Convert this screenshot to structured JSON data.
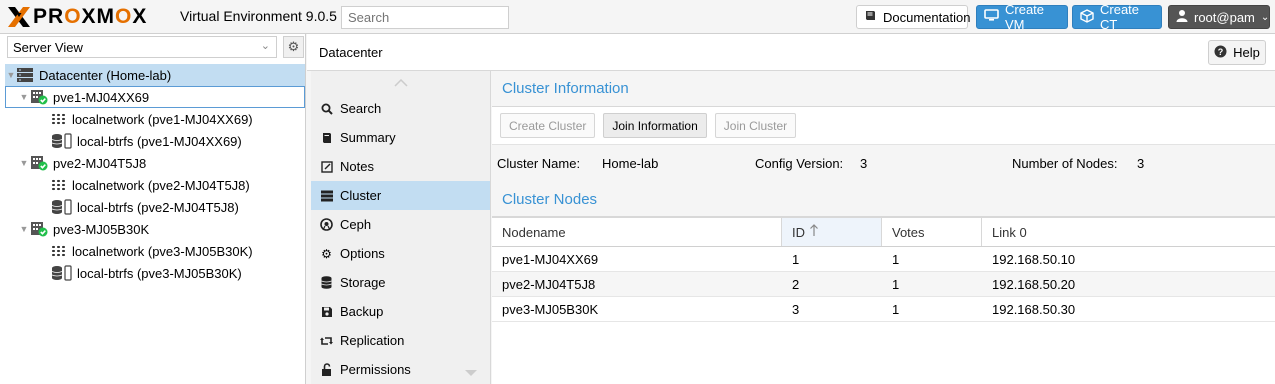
{
  "brand": {
    "logo_text": "PROXMOX",
    "version_text": "Virtual Environment 9.0.5",
    "accent": "#e57000"
  },
  "search": {
    "placeholder": "Search"
  },
  "toolbar": {
    "documentation": "Documentation",
    "create_vm": "Create VM",
    "create_ct": "Create CT",
    "user": "root@pam"
  },
  "sidebar": {
    "view_selector": "Server View",
    "tree": [
      {
        "label": "Datacenter (Home-lab)",
        "type": "datacenter"
      },
      {
        "label": "pve1-MJ04XX69",
        "type": "node"
      },
      {
        "label": "localnetwork (pve1-MJ04XX69)",
        "type": "network"
      },
      {
        "label": "local-btrfs (pve1-MJ04XX69)",
        "type": "storage"
      },
      {
        "label": "pve2-MJ04T5J8",
        "type": "node"
      },
      {
        "label": "localnetwork (pve2-MJ04T5J8)",
        "type": "network"
      },
      {
        "label": "local-btrfs (pve2-MJ04T5J8)",
        "type": "storage"
      },
      {
        "label": "pve3-MJ05B30K",
        "type": "node"
      },
      {
        "label": "localnetwork (pve3-MJ05B30K)",
        "type": "network"
      },
      {
        "label": "local-btrfs (pve3-MJ05B30K)",
        "type": "storage"
      }
    ]
  },
  "header": {
    "title": "Datacenter",
    "help": "Help"
  },
  "nav": {
    "items": [
      {
        "label": "Search",
        "icon": "search-icon"
      },
      {
        "label": "Summary",
        "icon": "book-icon"
      },
      {
        "label": "Notes",
        "icon": "notes-icon"
      },
      {
        "label": "Cluster",
        "icon": "server-icon"
      },
      {
        "label": "Ceph",
        "icon": "ceph-icon"
      },
      {
        "label": "Options",
        "icon": "gear-icon"
      },
      {
        "label": "Storage",
        "icon": "database-icon"
      },
      {
        "label": "Backup",
        "icon": "floppy-icon"
      },
      {
        "label": "Replication",
        "icon": "retweet-icon"
      },
      {
        "label": "Permissions",
        "icon": "unlock-icon"
      }
    ],
    "active": "Cluster"
  },
  "cluster_info": {
    "title": "Cluster Information",
    "buttons": {
      "create": "Create Cluster",
      "join_info": "Join Information",
      "join": "Join Cluster"
    },
    "name_label": "Cluster Name:",
    "name_value": "Home-lab",
    "config_label": "Config Version:",
    "config_value": "3",
    "nodes_label": "Number of Nodes:",
    "nodes_value": "3"
  },
  "cluster_nodes": {
    "title": "Cluster Nodes",
    "columns": [
      "Nodename",
      "ID",
      "Votes",
      "Link 0"
    ],
    "sorted_column": "ID",
    "rows": [
      [
        "pve1-MJ04XX69",
        "1",
        "1",
        "192.168.50.10"
      ],
      [
        "pve2-MJ04T5J8",
        "2",
        "1",
        "192.168.50.20"
      ],
      [
        "pve3-MJ05B30K",
        "3",
        "1",
        "192.168.50.30"
      ]
    ]
  }
}
